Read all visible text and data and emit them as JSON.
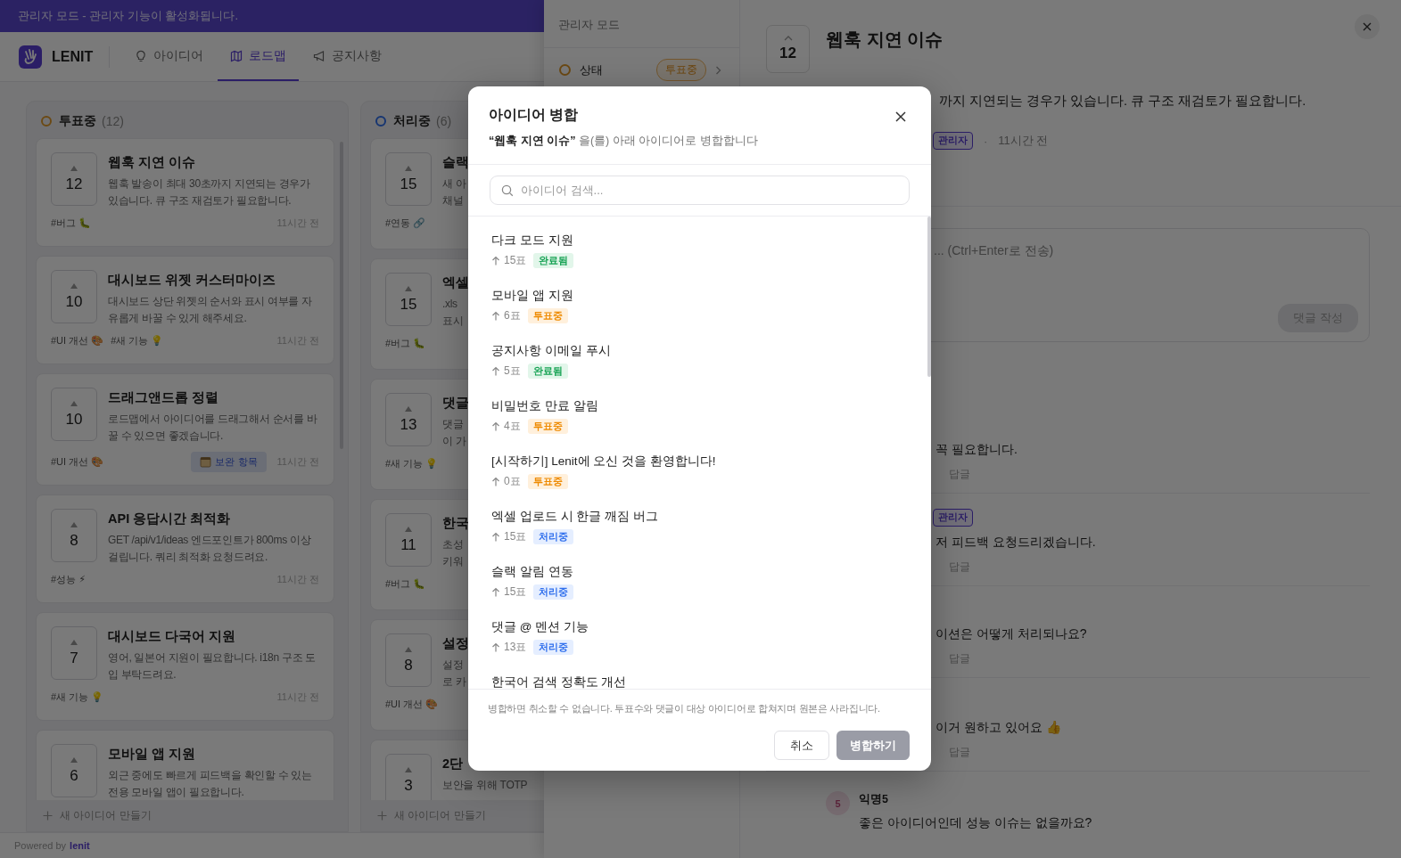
{
  "banner": "관리자 모드 - 관리자 기능이 활성화됩니다.",
  "brand": "LENIT",
  "nav": [
    {
      "label": "아이디어",
      "selected": false
    },
    {
      "label": "로드맵",
      "selected": true
    },
    {
      "label": "공지사항",
      "selected": false
    }
  ],
  "columns": [
    {
      "title": "투표중",
      "count": "(12)",
      "kind": "voting",
      "new_label": "새 아이디어 만들기",
      "cards": [
        {
          "votes": "12",
          "title": "웹훅 지연 이슈",
          "description": "웹훅 발송이 최대 30초까지 지연되는 경우가 있습니다. 큐 구조 재검토가 필요합니다.",
          "tags": [
            "#버그 🐛"
          ],
          "time": "11시간 전"
        },
        {
          "votes": "10",
          "title": "대시보드 위젯 커스터마이즈",
          "description": "대시보드 상단 위젯의 순서와 표시 여부를 자유롭게 바꿀 수 있게 해주세요.",
          "tags": [
            "#UI 개선 🎨",
            "#새 기능 💡"
          ],
          "time": "11시간 전"
        },
        {
          "votes": "10",
          "title": "드래그앤드롭 정렬",
          "description": "로드맵에서 아이디어를 드래그해서 순서를 바꿀 수 있으면 좋겠습니다.",
          "tags": [
            "#UI 개선 🎨"
          ],
          "badge": "보완 항목",
          "time": "11시간 전"
        },
        {
          "votes": "8",
          "title": "API 응답시간 최적화",
          "description": "GET /api/v1/ideas 엔드포인트가 800ms 이상 걸립니다. 쿼리 최적화 요청드려요.",
          "tags": [
            "#성능 ⚡"
          ],
          "time": "11시간 전"
        },
        {
          "votes": "7",
          "title": "대시보드 다국어 지원",
          "description": "영어, 일본어 지원이 필요합니다. i18n 구조 도입 부탁드려요.",
          "tags": [
            "#새 기능 💡"
          ],
          "time": "11시간 전"
        },
        {
          "votes": "6",
          "title": "모바일 앱 지원",
          "description": "외근 중에도 빠르게 피드백을 확인할 수 있는 전용 모바일 앱이 필요합니다."
        }
      ]
    },
    {
      "title": "처리중",
      "count": "(6)",
      "kind": "in_progress",
      "new_label": "새 아이디어 만들기",
      "cards": [
        {
          "votes": "15",
          "title": "슬랙",
          "description_lines": [
            "새 아",
            "채널"
          ],
          "tags": [
            "#연동 🔗"
          ]
        },
        {
          "votes": "15",
          "title": "엑셀",
          "description_lines": [
            ".xls",
            "표시"
          ],
          "tags": [
            "#버그 🐛"
          ]
        },
        {
          "votes": "13",
          "title": "댓글",
          "description_lines": [
            "댓글",
            "이 가"
          ],
          "tags": [
            "#새 기능 💡"
          ]
        },
        {
          "votes": "11",
          "title": "한국",
          "description_lines": [
            "초성",
            "키워"
          ],
          "tags": [
            "#버그 🐛"
          ]
        },
        {
          "votes": "8",
          "title": "설정",
          "description_lines": [
            "설정",
            "로 카"
          ],
          "tags": [
            "#UI 개선 🎨"
          ]
        },
        {
          "votes": "3",
          "title": "2단",
          "description_lines": [
            "보안을 위해 TOTP"
          ]
        }
      ]
    }
  ],
  "footer": {
    "prefix": "Powered by",
    "link": "lenit"
  },
  "drawer": {
    "sidebar": {
      "title": "관리자 모드",
      "rows": [
        {
          "label": "상태",
          "value": "투표중",
          "kind": "voting"
        }
      ]
    },
    "detail": {
      "votes": "12",
      "title": "웹훅 지연 이슈",
      "description": "까지 지연되는 경우가 있습니다. 큐 구조 재검토가 필요합니다.",
      "author_badge": "관리자",
      "separator": "·",
      "time": "11시간 전",
      "comment_placeholder": "... (Ctrl+Enter로 전송)",
      "submit": "댓글 작성",
      "comments": [
        {
          "text": "꼭 필요합니다.",
          "reply": "답글"
        },
        {
          "badge": "관리자",
          "text": "저 피드백 요청드리겠습니다.",
          "reply": "답글"
        },
        {
          "text": "이션은 어떻게 처리되나요?",
          "reply": "답글"
        },
        {
          "text": "이거 원하고 있어요 👍",
          "reply": "답글"
        },
        {
          "avatar": "5",
          "author": "익명5",
          "text": "좋은 아이디어인데 성능 이슈는 없을까요?"
        }
      ]
    }
  },
  "modal": {
    "title": "아이디어 병합",
    "subtitle": "**“웹훅 지연 이슈”** 을(를) 아래 아이디어로 병합합니다",
    "search_placeholder": "아이디어 검색...",
    "items": [
      {
        "title": "다크 모드 지원",
        "votes": "15표",
        "kind": "done",
        "status_label": "완료됨"
      },
      {
        "title": "모바일 앱 지원",
        "votes": "6표",
        "kind": "voting",
        "status_label": "투표중"
      },
      {
        "title": "공지사항 이메일 푸시",
        "votes": "5표",
        "kind": "done",
        "status_label": "완료됨"
      },
      {
        "title": "비밀번호 만료 알림",
        "votes": "4표",
        "kind": "voting",
        "status_label": "투표중"
      },
      {
        "title": "[시작하기] Lenit에 오신 것을 환영합니다!",
        "votes": "0표",
        "kind": "voting",
        "status_label": "투표중"
      },
      {
        "title": "엑셀 업로드 시 한글 깨짐 버그",
        "votes": "15표",
        "kind": "in_progress",
        "status_label": "처리중"
      },
      {
        "title": "슬랙 알림 연동",
        "votes": "15표",
        "kind": "in_progress",
        "status_label": "처리중"
      },
      {
        "title": "댓글 @ 멘션 기능",
        "votes": "13표",
        "kind": "in_progress",
        "status_label": "처리중"
      },
      {
        "title": "한국어 검색 정확도 개선"
      }
    ],
    "note": "병합하면 취소할 수 없습니다. 투표수와 댓글이 대상 아이디어로 합쳐지며 원본은 사라집니다.",
    "cancel": "취소",
    "confirm": {
      "label": "병합하기",
      "disabled": true
    }
  }
}
